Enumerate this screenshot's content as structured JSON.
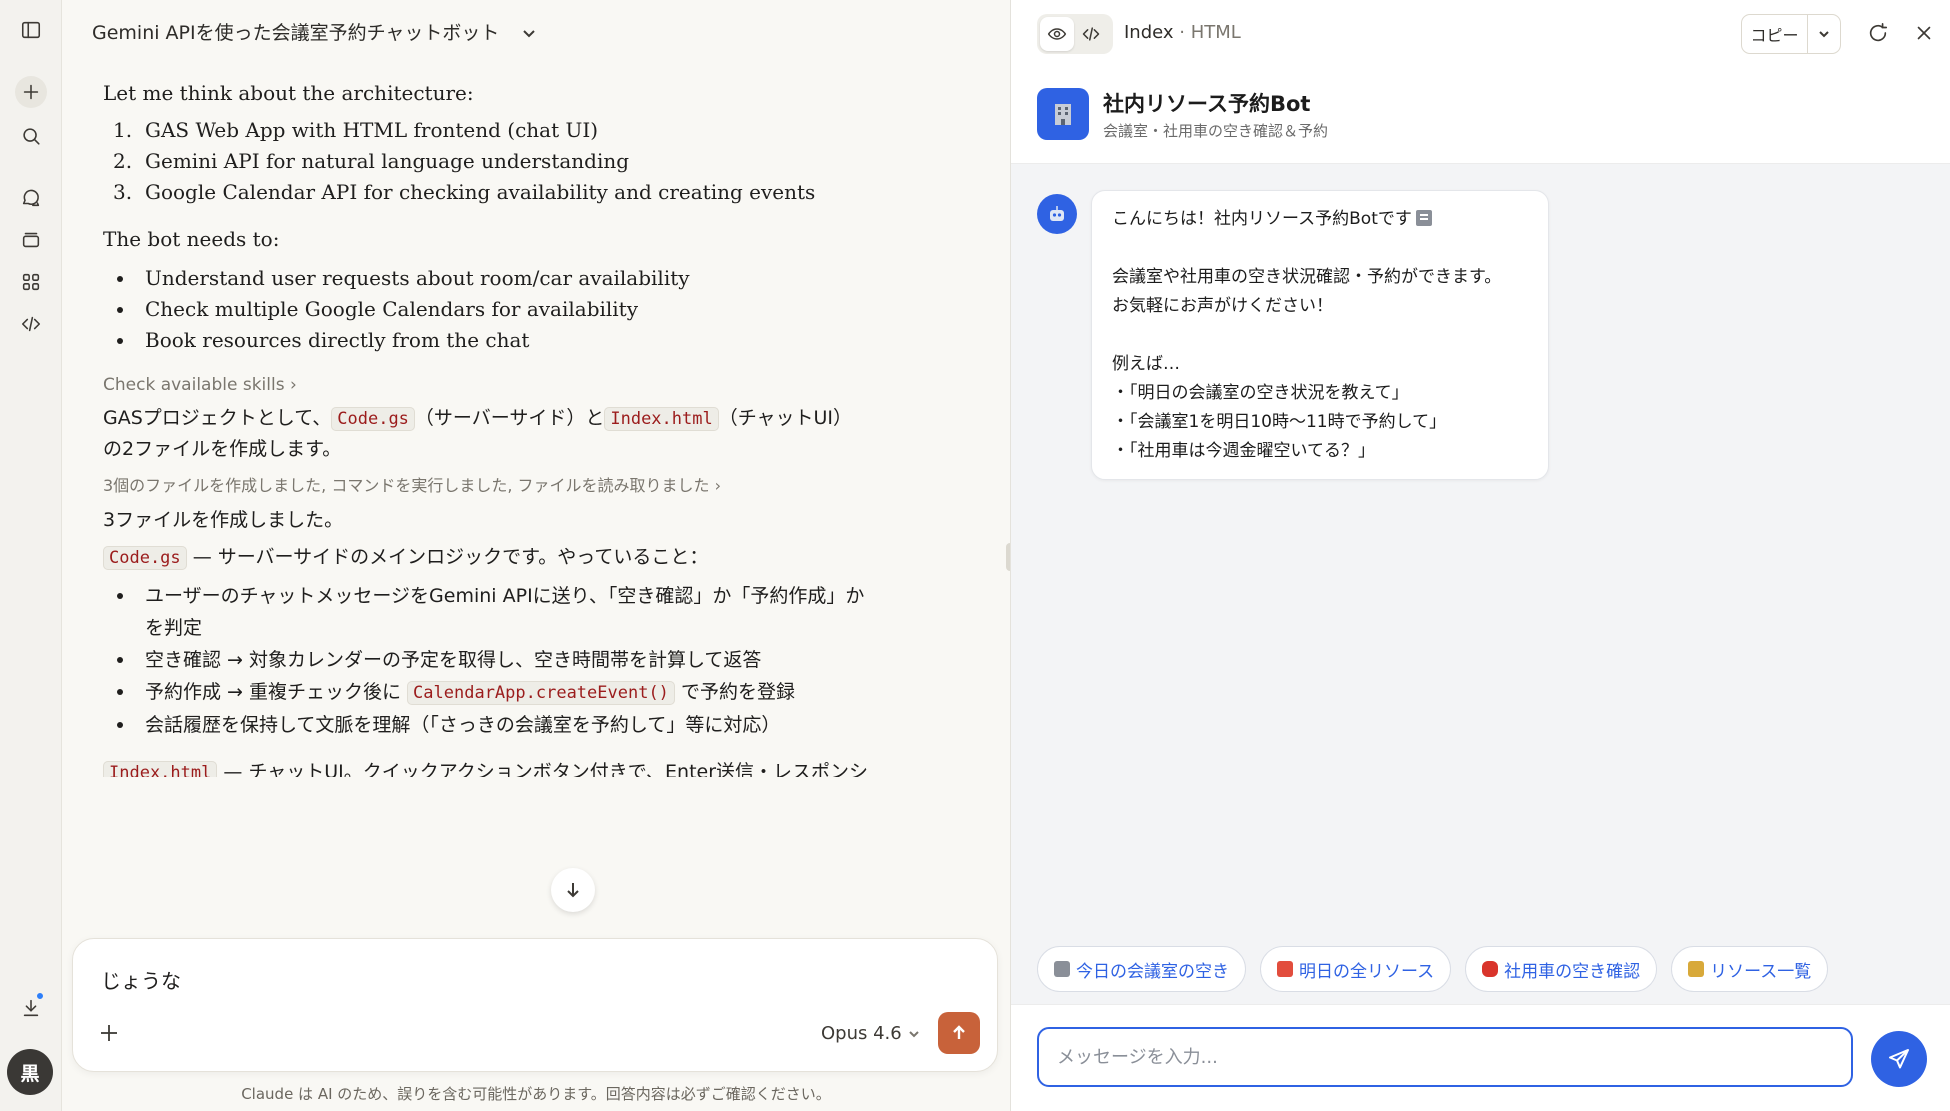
{
  "chat": {
    "title": "Gemini APIを使った会議室予約チャットボット",
    "arch_intro": "Let me think about the architecture:",
    "arch_items": [
      {
        "num": "1.",
        "text": "GAS Web App with HTML frontend (chat UI)"
      },
      {
        "num": "2.",
        "text": "Gemini API for natural language understanding"
      },
      {
        "num": "3.",
        "text": "Google Calendar API for checking availability and creating events"
      }
    ],
    "needs_intro": "The bot needs to:",
    "needs_items": [
      "Understand user requests about room/car availability",
      "Check multiple Google Calendars for availability",
      "Book resources directly from the chat"
    ],
    "skills_link": "Check available skills",
    "gas_p_1": "GASプロジェクトとして、",
    "gas_code_1": "Code.gs",
    "gas_p_2": "（サーバーサイド）と",
    "gas_code_2": "Index.html",
    "gas_p_3": "（チャットUI）",
    "gas_p_4": "の2ファイルを作成します。",
    "tool_summary": "3個のファイルを作成しました, コマンドを実行しました, ファイルを読み取りました",
    "created": "3ファイルを作成しました。",
    "codegs_label": "Code.gs",
    "codegs_desc": " — サーバーサイドのメインロジックです。やっていること：",
    "codegs_item_1a": "ユーザーのチャットメッセージをGemini APIに送り、「空き確認」か「予約作成」か",
    "codegs_item_1b": "を判定",
    "codegs_item_2": "空き確認 → 対象カレンダーの予定を取得し、空き時間帯を計算して返答",
    "codegs_item_3a": "予約作成 → 重複チェック後に",
    "codegs_item_3code": "CalendarApp.createEvent()",
    "codegs_item_3b": "で予約を登録",
    "codegs_item_4": "会話履歴を保持して文脈を理解（「さっきの会議室を予約して」等に対応）",
    "index_label": "Index.html",
    "index_desc": " — チャットUI。クイックアクションボタン付きで、Enter送信・レスポンシ"
  },
  "composer": {
    "text": "じょうな",
    "model": "Opus 4.6"
  },
  "disclaimer": "Claude は AI のため、誤りを含む可能性があります。回答内容は必ずご確認ください。",
  "user": {
    "avatar_initial": "黒"
  },
  "artifact": {
    "title": "Index",
    "type": "HTML",
    "copy_label": "コピー"
  },
  "bot": {
    "name": "社内リソース予約Bot",
    "subtitle": "会議室・社用車の空き確認＆予約",
    "greeting": "こんにちは！社内リソース予約Botです",
    "line_1": "会議室や社用車の空き状況確認・予約ができます。",
    "line_2": "お気軽にお声がけください！",
    "examples_intro": "例えば…",
    "examples": [
      "・「明日の会議室の空き状況を教えて」",
      "・「会議室1を明日10時〜11時で予約して」",
      "・「社用車は今週金曜空いてる？」"
    ],
    "chips": [
      {
        "label": "今日の会議室の空き",
        "icon": "memo-icon",
        "color": "#8a8f98"
      },
      {
        "label": "明日の全リソース",
        "icon": "calendar-icon",
        "color": "#e24d3d"
      },
      {
        "label": "社用車の空き確認",
        "icon": "car-icon",
        "color": "#d9342b"
      },
      {
        "label": "リソース一覧",
        "icon": "note-icon",
        "color": "#d8a93a"
      }
    ],
    "input_placeholder": "メッセージを入力..."
  },
  "colors": {
    "accent_blue": "#2f62e3",
    "send_orange": "#c8623a",
    "code_red": "#9b1c1c"
  }
}
